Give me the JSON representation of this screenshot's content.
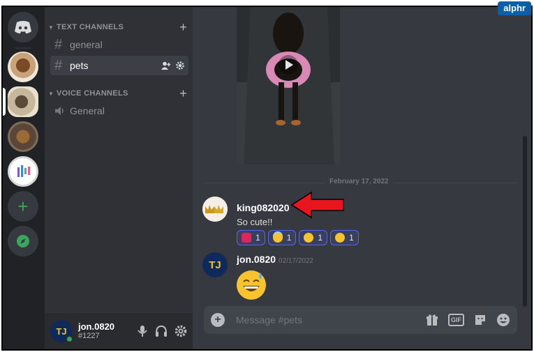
{
  "watermark": "alphr",
  "colors": {
    "accent": "#5865f2",
    "online": "#3ba55d",
    "arrow": "#e8141e"
  },
  "sidebar": {
    "text_category": "TEXT CHANNELS",
    "voice_category": "VOICE CHANNELS",
    "text_channels": [
      {
        "name": "general",
        "active": false
      },
      {
        "name": "pets",
        "active": true
      }
    ],
    "voice_channels": [
      {
        "name": "General"
      }
    ]
  },
  "user": {
    "name": "jon.0820",
    "tag": "#1227",
    "avatar_text": "TJ"
  },
  "chat": {
    "date_divider": "February 17, 2022",
    "messages": [
      {
        "author": "king082020",
        "text": "So cute!!",
        "reactions": [
          {
            "emoji": "heart-icon",
            "count": "1"
          },
          {
            "emoji": "halo-face-icon",
            "count": "1"
          },
          {
            "emoji": "kiss-face-icon",
            "count": "1"
          },
          {
            "emoji": "smile-face-icon",
            "count": "1"
          }
        ]
      },
      {
        "author": "jon.0820",
        "timestamp": "02/17/2022",
        "avatar_text": "TJ",
        "emoji": "sweat-smile-icon"
      }
    ],
    "composer_placeholder": "Message #pets"
  }
}
